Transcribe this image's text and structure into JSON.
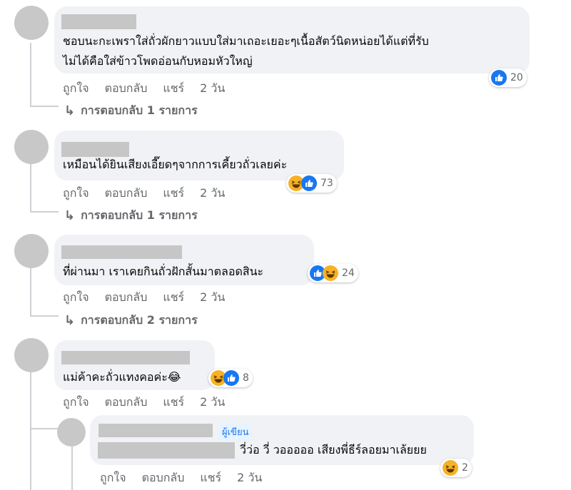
{
  "actions": {
    "like": "ถูกใจ",
    "reply": "ตอบกลับ",
    "share": "แชร์",
    "time": "2 วัน"
  },
  "comments": [
    {
      "line1": "ชอบนะกะเพราใส่ถั่วผักยาวแบบใส่มาเถอะเยอะๆเนื้อสัตว์นิดหน่อยได้แต่ที่รับ",
      "line2": "ไม่ได้คือใส่ข้าวโพดอ่อนกับหอมหัวใหญ่",
      "reactions": [
        "like"
      ],
      "reaction_count": "20",
      "replies_label": "การตอบกลับ 1 รายการ"
    },
    {
      "line1": "เหมือนได้ยินเสียงเอี๊ยดๆจากการเคี้ยวถั่วเลยค่ะ",
      "reactions": [
        "haha",
        "like"
      ],
      "reaction_count": "73",
      "replies_label": "การตอบกลับ 1 รายการ"
    },
    {
      "line1": "ที่ผ่านมา เราเคยกินถั่วฝักสั้นมาตลอดสินะ",
      "reactions": [
        "like",
        "haha"
      ],
      "reaction_count": "24",
      "replies_label": "การตอบกลับ 2 รายการ"
    },
    {
      "line1": "แม่ค้าคะถั่วแทงคอค่ะ😂",
      "reactions": [
        "haha",
        "like"
      ],
      "reaction_count": "8"
    }
  ],
  "reply": {
    "author_badge": "ผู้เขียน",
    "text": "วี่ว่อ วี่ วอออออ เสียงพี่ธีร์ลอยมาเล้ยยย",
    "reactions": [
      "haha"
    ],
    "reaction_count": "2"
  }
}
